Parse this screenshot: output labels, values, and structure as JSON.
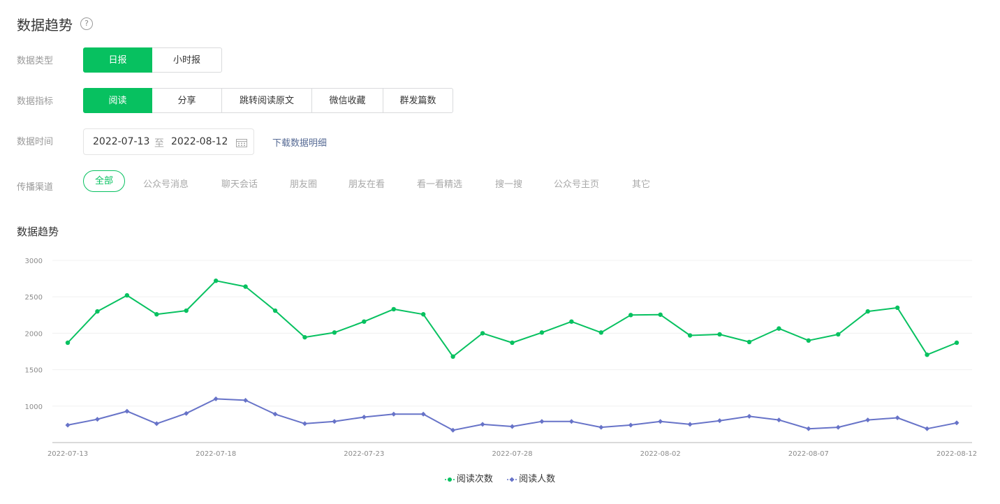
{
  "header": {
    "title": "数据趋势",
    "help_glyph": "?"
  },
  "filters": {
    "type": {
      "label": "数据类型",
      "options": [
        "日报",
        "小时报"
      ],
      "selected": "日报"
    },
    "metric": {
      "label": "数据指标",
      "options": [
        "阅读",
        "分享",
        "跳转阅读原文",
        "微信收藏",
        "群发篇数"
      ],
      "selected": "阅读"
    },
    "time": {
      "label": "数据时间",
      "start": "2022-07-13",
      "separator": "至",
      "end": "2022-08-12",
      "download_label": "下载数据明细"
    },
    "channel": {
      "label": "传播渠道",
      "options": [
        "全部",
        "公众号消息",
        "聊天会话",
        "朋友圈",
        "朋友在看",
        "看一看精选",
        "搜一搜",
        "公众号主页",
        "其它"
      ],
      "selected": "全部"
    }
  },
  "colors": {
    "accent": "#07c160",
    "series_reads": "#07c160",
    "series_readers": "#6773c8",
    "link": "#576b95"
  },
  "chart_data": {
    "type": "line",
    "title": "数据趋势",
    "x": [
      "2022-07-13",
      "2022-07-14",
      "2022-07-15",
      "2022-07-16",
      "2022-07-17",
      "2022-07-18",
      "2022-07-19",
      "2022-07-20",
      "2022-07-21",
      "2022-07-22",
      "2022-07-23",
      "2022-07-24",
      "2022-07-25",
      "2022-07-26",
      "2022-07-27",
      "2022-07-28",
      "2022-07-29",
      "2022-07-30",
      "2022-07-31",
      "2022-08-01",
      "2022-08-02",
      "2022-08-03",
      "2022-08-04",
      "2022-08-05",
      "2022-08-06",
      "2022-08-07",
      "2022-08-08",
      "2022-08-09",
      "2022-08-10",
      "2022-08-11",
      "2022-08-12"
    ],
    "x_ticks": [
      "2022-07-13",
      "2022-07-18",
      "2022-07-23",
      "2022-07-28",
      "2022-08-02",
      "2022-08-07",
      "2022-08-12"
    ],
    "y_ticks": [
      1000,
      1500,
      2000,
      2500,
      3000
    ],
    "ylim": [
      500,
      3000
    ],
    "grid": true,
    "legend": "bottom-center",
    "series": [
      {
        "name": "阅读次数",
        "values": [
          1870,
          2300,
          2520,
          2260,
          2310,
          2720,
          2640,
          2310,
          1945,
          2010,
          2160,
          2330,
          2260,
          1680,
          2000,
          1870,
          2010,
          2160,
          2010,
          2250,
          2255,
          1970,
          1985,
          1880,
          2065,
          1900,
          1985,
          2300,
          2350,
          1705,
          1870
        ]
      },
      {
        "name": "阅读人数",
        "values": [
          740,
          820,
          930,
          760,
          900,
          1100,
          1080,
          890,
          760,
          790,
          850,
          890,
          890,
          670,
          750,
          720,
          790,
          790,
          710,
          740,
          790,
          750,
          800,
          860,
          810,
          690,
          710,
          810,
          840,
          690,
          770
        ]
      }
    ]
  }
}
